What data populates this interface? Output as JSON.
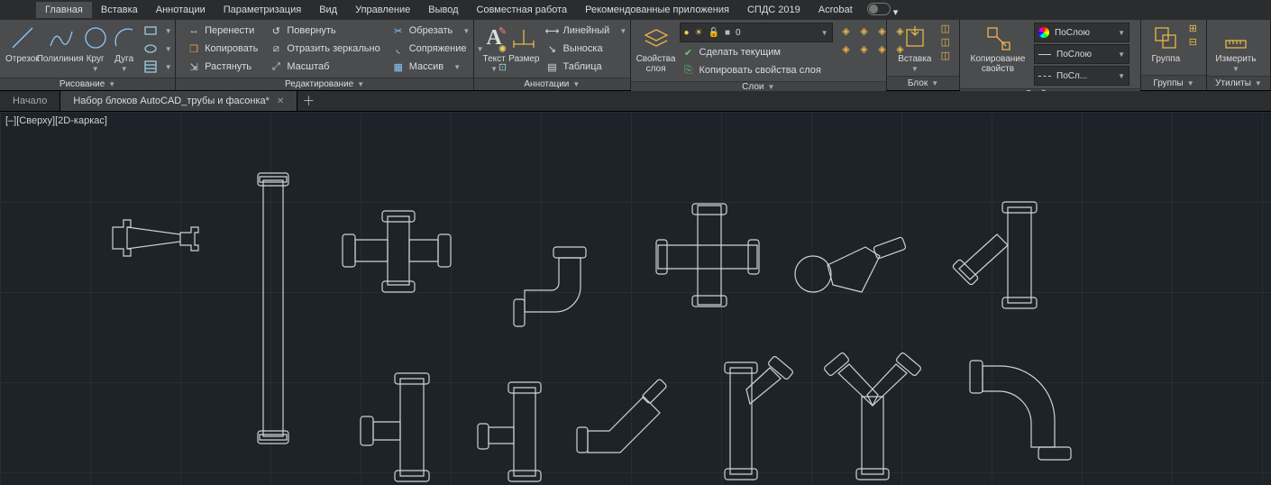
{
  "menu_tabs": {
    "home": "Главная",
    "insert": "Вставка",
    "annotate": "Аннотации",
    "parametric": "Параметризация",
    "view": "Вид",
    "manage": "Управление",
    "output": "Вывод",
    "collab": "Совместная работа",
    "featured": "Рекомендованные приложения",
    "spds": "СПДС 2019",
    "acrobat": "Acrobat"
  },
  "panels": {
    "draw": {
      "title": "Рисование",
      "line": "Отрезок",
      "polyline": "Полилиния",
      "circle": "Круг",
      "arc": "Дуга"
    },
    "modify": {
      "title": "Редактирование",
      "move": "Перенести",
      "rotate": "Повернуть",
      "trim": "Обрезать",
      "copy": "Копировать",
      "mirror": "Отразить зеркально",
      "fillet": "Сопряжение",
      "stretch": "Растянуть",
      "scale": "Масштаб",
      "array": "Массив"
    },
    "annotation": {
      "title": "Аннотации",
      "text": "Текст",
      "dim": "Размер",
      "linear": "Линейный",
      "leader": "Выноска",
      "table": "Таблица"
    },
    "layers": {
      "title": "Слои",
      "props": "Свойства\nслоя",
      "current": "0",
      "mkcurrent": "Сделать текущим",
      "copyprops": "Копировать свойства слоя"
    },
    "block": {
      "title": "Блок",
      "insert": "Вставка"
    },
    "props": {
      "title": "Свойства",
      "match": "Копирование\nсвойств",
      "bylayer": "ПоСлою",
      "bylayer2": "ПоСлою",
      "bylayer3": "ПоСл..."
    },
    "groups": {
      "title": "Группы",
      "group": "Группа"
    },
    "utils": {
      "title": "Утилиты",
      "measure": "Измерить"
    }
  },
  "docs": {
    "start": "Начало",
    "active": "Набор блоков AutoCAD_трубы и фасонка*"
  },
  "viewport": "[–][Сверху][2D-каркас]"
}
